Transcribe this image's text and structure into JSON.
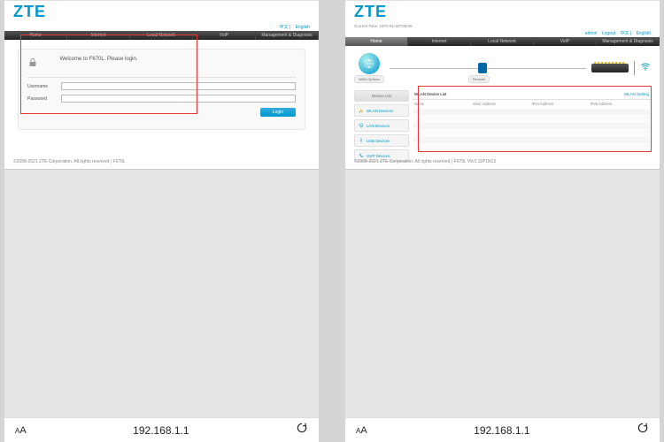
{
  "brand": "ZTE",
  "url": "192.168.1.1",
  "lang_cn": "中文",
  "lang_en": "English",
  "lang_sep": " | ",
  "nav": [
    "Home",
    "Internet",
    "Local Network",
    "VoIP",
    "Management & Diagnosis"
  ],
  "login": {
    "title": "Welcome to F670L. Please login.",
    "username_label": "Username",
    "password_label": "Password",
    "button": "Login"
  },
  "footer1": "©2008-2021 ZTE Corporation. All rights reserved  |   F670L",
  "dash": {
    "current_time": "Current Time: 1970-01-02T08:06",
    "admin": "admin",
    "logout": "Logout",
    "wan_label": "WAN Options",
    "firewall": "Firewall",
    "side_header": "Device List",
    "side_items": [
      "WLAN Devices",
      "LAN Devices",
      "USB Devices",
      "VoIP Devices"
    ],
    "panel_title": "WLAN Device List",
    "panel_link": "WLAN Setting",
    "cols": [
      "Name",
      "MAC Address",
      "IPv4 Address",
      "IPv6 Address"
    ]
  },
  "footer2": "©2008-2021 ZTE Corporation. All rights reserved  |   F670L V9.0.11P1N13"
}
